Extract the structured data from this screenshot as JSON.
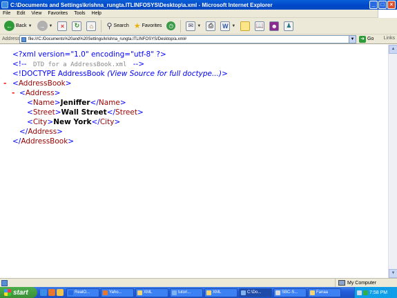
{
  "window": {
    "title": "C:\\Documents and Settings\\krishna_rungta.ITLINFOSYS\\Desktop\\a.xml - Microsoft Internet Explorer"
  },
  "menu": [
    "File",
    "Edit",
    "View",
    "Favorites",
    "Tools",
    "Help"
  ],
  "toolbar": {
    "back_label": "Back",
    "search_label": "Search",
    "favorites_label": "Favorites"
  },
  "address": {
    "label": "Address",
    "url": "file:///C:/Documents%20and%20Settings/krishna_rungta.ITLINFOSYS/Desktop/a.xml#",
    "go_label": "Go",
    "links_label": "Links"
  },
  "xml": {
    "decl": "<?xml version=\"1.0\" encoding=\"utf-8\" ?>",
    "comment_open": "<!--",
    "comment_text": "DTD for a AddressBook.xml",
    "comment_close": "-->",
    "doctype_open": "<!DOCTYPE AddressBook ",
    "doctype_note": "(View Source for full doctype...)",
    "doctype_close": ">",
    "toggle": "-",
    "lt": "<",
    "gt": ">",
    "lt_slash": "</",
    "address_book_tag": "AddressBook",
    "address_tag": "Address",
    "name_tag": "Name",
    "name_value": "Jeniffer",
    "street_tag": "Street",
    "street_value": "Wall Street",
    "city_tag": "City",
    "city_value": "New York"
  },
  "status": {
    "zone": "My Computer"
  },
  "taskbar": {
    "start_label": "start",
    "tasks": [
      "RealO...",
      "Yaho...",
      "XML",
      "tutori...",
      "XML",
      "C:\\Do...",
      "SBC-S...",
      "Fanaa"
    ],
    "clock": "7:58 PM"
  }
}
